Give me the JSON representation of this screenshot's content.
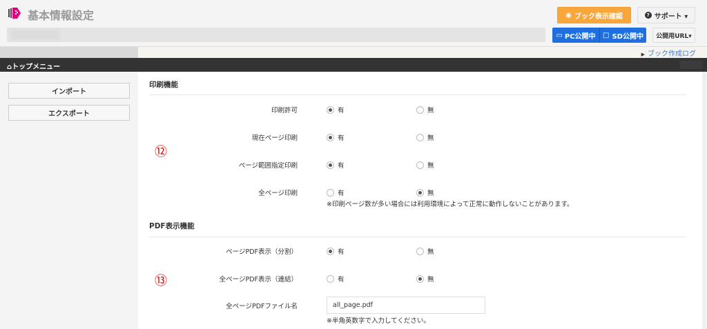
{
  "header": {
    "title": "基本情報設定",
    "preview_button": "ブック表示確認",
    "support_button": "サポート ▾",
    "pc_button": "PC公開中",
    "sd_button": "SD公開中",
    "url_button": "公開用URL▾",
    "book_log_link": "ブック作成ログ"
  },
  "nav": {
    "top_menu": "トップメニュー"
  },
  "sidebar": {
    "items": [
      {
        "label": "インポート"
      },
      {
        "label": "エクスポート"
      }
    ]
  },
  "print": {
    "title": "印刷機能",
    "marker": "⑫",
    "rows": [
      {
        "label": "印刷許可",
        "yes": "有",
        "no": "無",
        "selected": "有"
      },
      {
        "label": "現在ページ印刷",
        "yes": "有",
        "no": "無",
        "selected": "有"
      },
      {
        "label": "ページ範囲指定印刷",
        "yes": "有",
        "no": "無",
        "selected": "有"
      },
      {
        "label": "全ページ印刷",
        "yes": "有",
        "no": "無",
        "selected": "無"
      }
    ],
    "note": "※印刷ページ数が多い場合には利用環境によって正常に動作しないことがあります。"
  },
  "pdf": {
    "title": "PDF表示機能",
    "marker": "⑬",
    "rows": [
      {
        "label": "ページPDF表示（分割）",
        "yes": "有",
        "no": "無",
        "selected": "有"
      },
      {
        "label": "全ページPDF表示（連結）",
        "yes": "有",
        "no": "無",
        "selected": "無"
      }
    ],
    "filename_label": "全ページPDFファイル名",
    "filename_value": "all_page.pdf",
    "filename_note": "※半角英数字で入力してください。"
  },
  "colors": {
    "accent_orange": "#f9a63a",
    "accent_blue": "#1f6fe0",
    "logo": "#e4007f",
    "marker": "#e00000"
  }
}
